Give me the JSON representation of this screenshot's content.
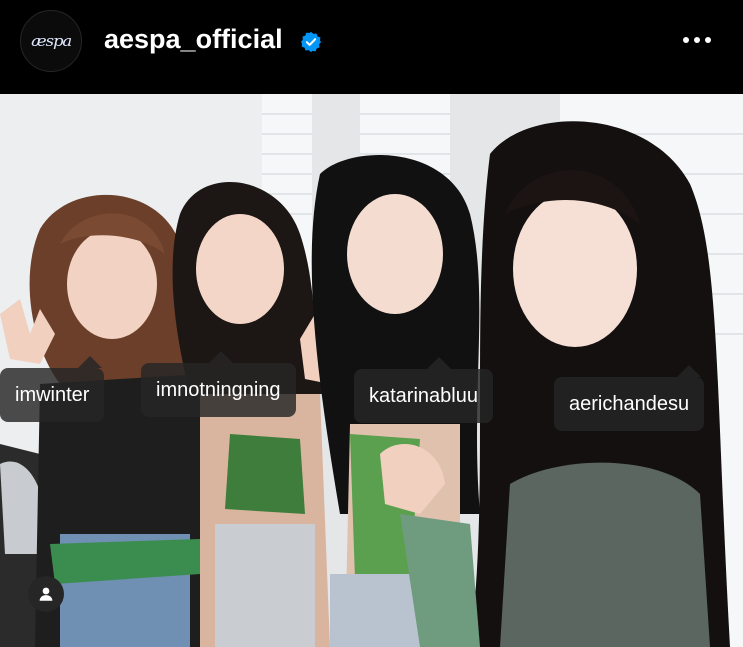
{
  "post": {
    "username": "aespa_official",
    "avatar_text": "æspa",
    "verified": true
  },
  "tags": [
    {
      "handle": "imwinter"
    },
    {
      "handle": "imnotningning"
    },
    {
      "handle": "katarinabluu"
    },
    {
      "handle": "aerichandesu"
    }
  ],
  "icons": {
    "verified": "verified-badge-icon",
    "more": "more-options-icon",
    "tagged_users": "tagged-users-icon"
  },
  "colors": {
    "background": "#000000",
    "verified_badge": "#0095f6",
    "tag_background": "#262626"
  }
}
